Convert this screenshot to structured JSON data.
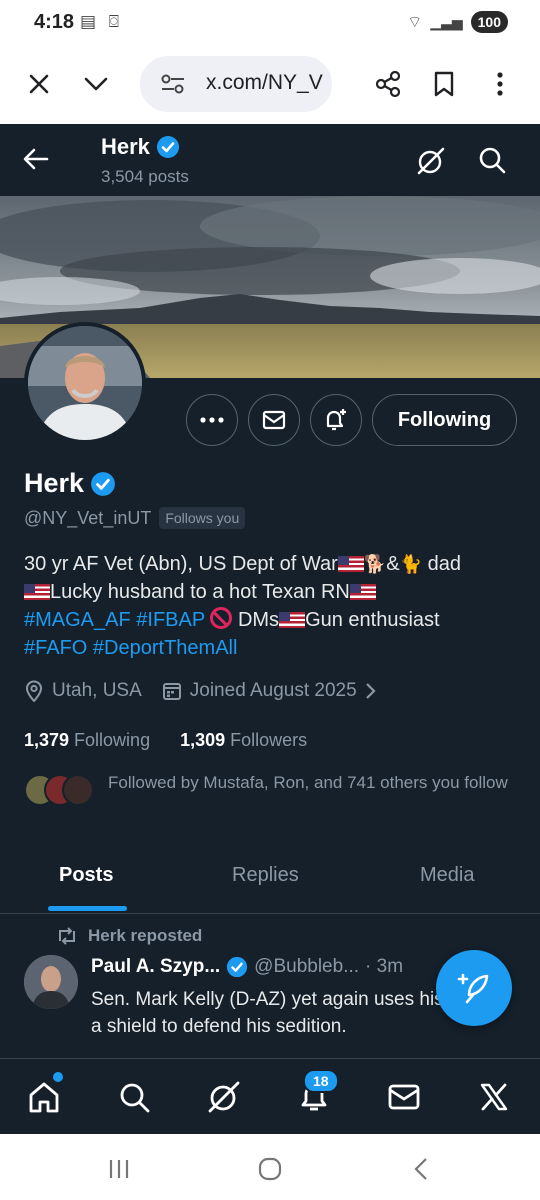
{
  "status_bar": {
    "time": "4:18",
    "battery": "100"
  },
  "browser": {
    "url": "x.com/NY_V"
  },
  "header": {
    "name": "Herk",
    "posts_count": "3,504 posts"
  },
  "profile": {
    "name": "Herk",
    "handle": "@NY_Vet_inUT",
    "follows_you": "Follows you",
    "following_button": "Following",
    "bio": {
      "line1_a": "30 yr AF Vet (Abn), US Dept of War",
      "line1_b": "&",
      "line1_c": " dad",
      "line2_a": "Lucky husband to a hot Texan  RN",
      "line3_tag1": "#MAGA_AF",
      "line3_tag2": "#IFBAP",
      "line3_b": " DMs",
      "line3_c": "Gun enthusiast",
      "line4_tag1": "#FAFO",
      "line4_tag2": "#DeportThemAll"
    },
    "location": "Utah, USA",
    "joined": "Joined August 2025",
    "following_count": "1,379",
    "following_label": "Following",
    "followers_count": "1,309",
    "followers_label": "Followers",
    "followed_by": "Followed by Mustafa, Ron, and 741 others you follow"
  },
  "tabs": [
    {
      "label": "Posts",
      "active": true
    },
    {
      "label": "Replies",
      "active": false
    },
    {
      "label": "Media",
      "active": false
    }
  ],
  "tweet": {
    "repost_label": "Herk reposted",
    "author_name": "Paul A. Szyp...",
    "author_handle": "@Bubbleb...",
    "time": "· 3m",
    "text": "Sen. Mark Kelly (D-AZ) yet again uses his wife as a shield to defend his sedition."
  },
  "bottom_nav": {
    "notifications_badge": "18"
  },
  "colors": {
    "background": "#15202b",
    "accent": "#1d9bf0",
    "muted": "#8b98a5"
  }
}
